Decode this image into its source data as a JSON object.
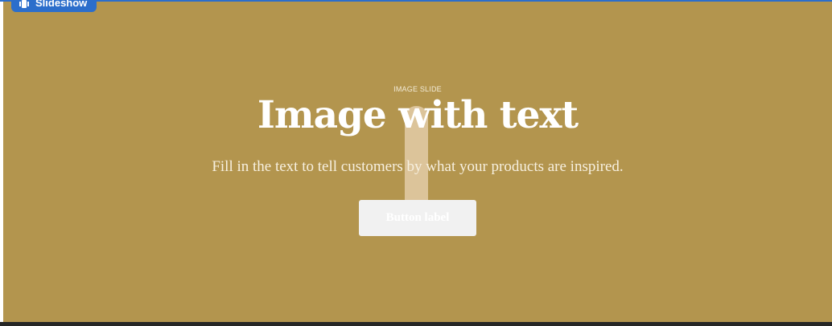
{
  "badge": {
    "label": "Slideshow",
    "icon": "slideshow-icon"
  },
  "slide": {
    "eyebrow": "IMAGE SLIDE",
    "heading": "Image with text",
    "subtext": "Fill in the text to tell customers by what your products are inspired.",
    "button_label": "Button label"
  },
  "colors": {
    "slide_background": "#b3954e",
    "accent": "#2c6ecb",
    "button_background": "#f1f1f1",
    "text": "#ffffff"
  }
}
